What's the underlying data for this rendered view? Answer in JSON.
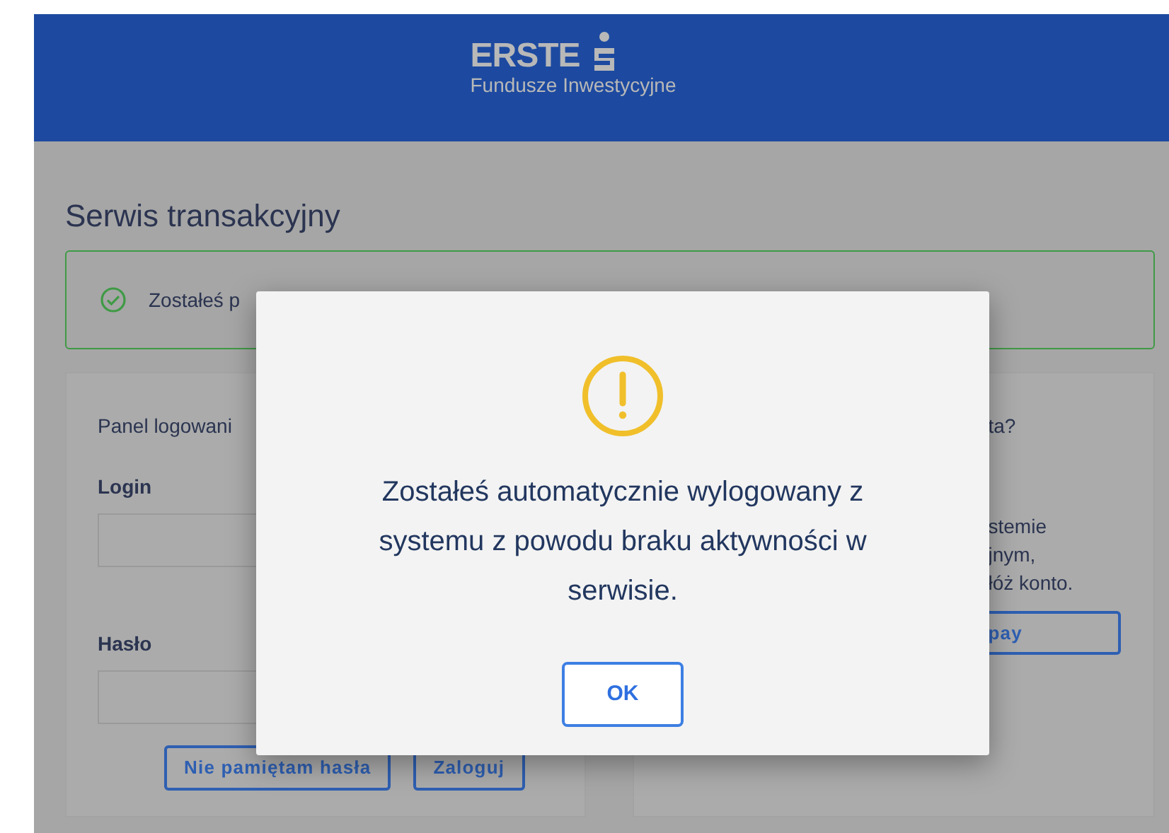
{
  "header": {
    "logo_name": "ERSTE",
    "logo_subtitle": "Fundusze Inwestycyjne"
  },
  "page_title": "Serwis transakcyjny",
  "alert": {
    "kind": "success",
    "text": "Zostałeś p"
  },
  "login_panel": {
    "title": "Panel logowani",
    "fields": [
      {
        "label": "Login"
      },
      {
        "label": "Hasło"
      }
    ],
    "buttons": [
      "Nie pamiętam hasła",
      "Zaloguj"
    ]
  },
  "register_panel": {
    "title": "ta?",
    "text_lines": [
      "stemie",
      "jnym,",
      "łóż konto."
    ],
    "button": "pay"
  },
  "dialog": {
    "kind": "warning",
    "message": "Zostałeś automatycznie wylogowany z systemu z powodu braku aktywności w serwisie.",
    "button": "OK"
  }
}
